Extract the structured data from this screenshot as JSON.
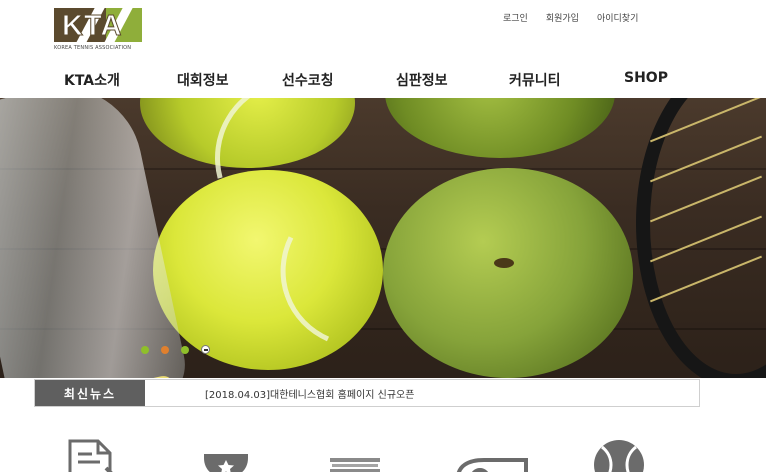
{
  "logo": {
    "mark": "KTA",
    "subtitle": "KOREA TENNIS ASSOCIATION"
  },
  "top_links": {
    "login": "로그인",
    "signup": "회원가입",
    "find_id": "아이디찾기"
  },
  "gnb": [
    "KTA소개",
    "대회정보",
    "선수코칭",
    "심판정보",
    "커뮤니티",
    "SHOP"
  ],
  "hero": {
    "slides": 4,
    "active_slide": 1,
    "dot_colors": [
      "#8fbf2a",
      "#e0802e",
      "#8fbf2a"
    ]
  },
  "news": {
    "tag": "최신뉴스",
    "headline": "[2018.04.03]대한테니스협회 홈페이지 신규오픈"
  },
  "quick_icons": [
    "document-icon",
    "trophy-icon",
    "book-icon",
    "whistle-icon",
    "tennis-ball-icon"
  ],
  "colors": {
    "news_tag_bg": "#5f5f5f",
    "logo_brown": "#5b4a2e",
    "logo_green": "#8fae3a"
  }
}
